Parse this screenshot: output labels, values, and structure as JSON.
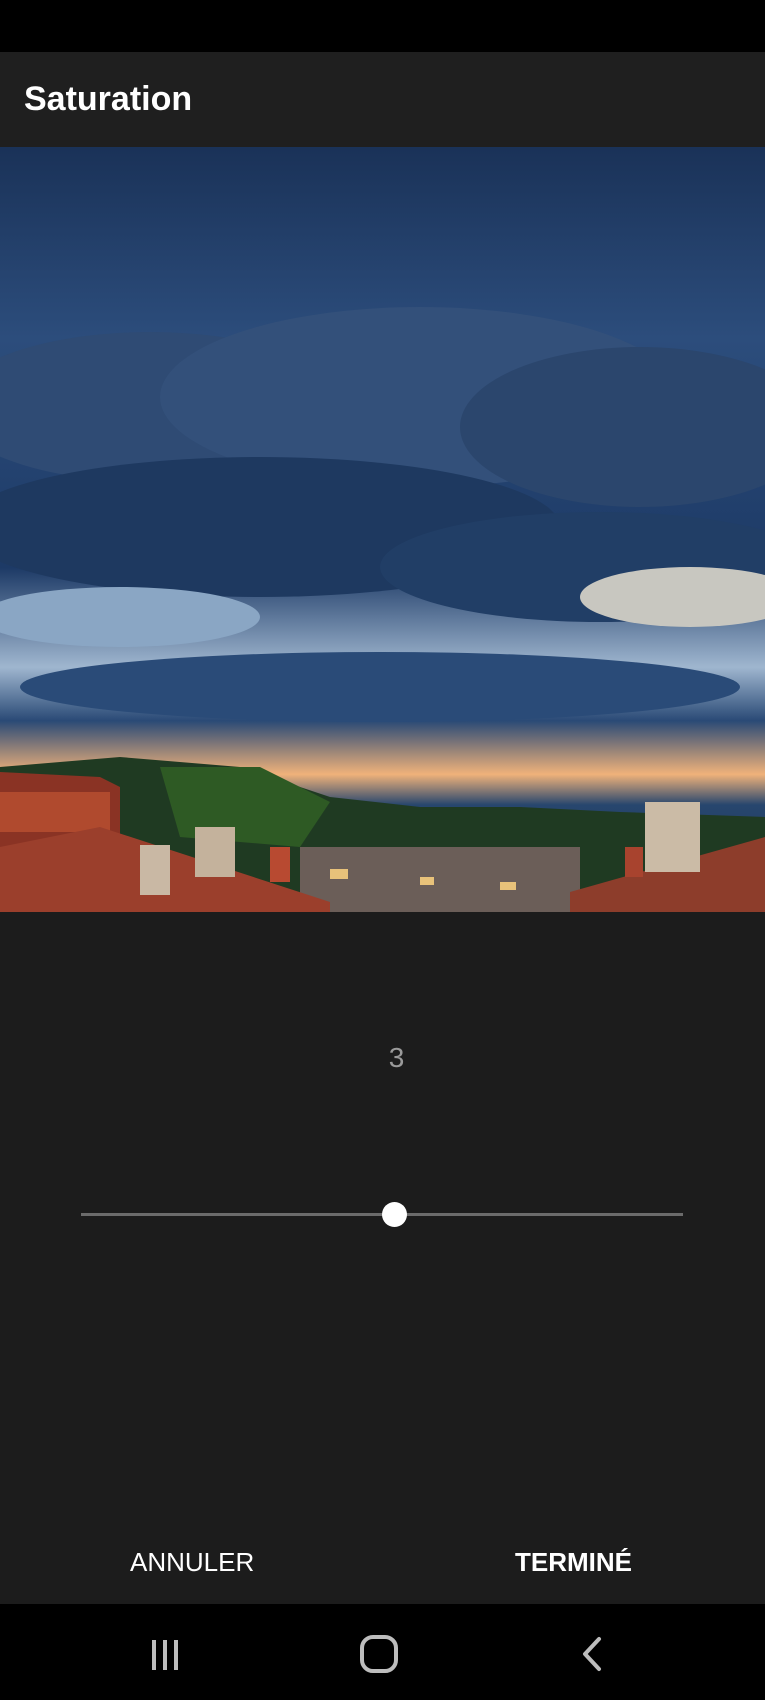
{
  "header": {
    "title": "Saturation"
  },
  "photo": {
    "icon": "landscape-photo"
  },
  "adjustment": {
    "value": "3",
    "slider_position": 0.52
  },
  "actions": {
    "cancel_label": "ANNULER",
    "done_label": "TERMINÉ"
  },
  "nav": {
    "recents_icon": "recents-icon",
    "home_icon": "home-icon",
    "back_icon": "back-icon"
  },
  "colors": {
    "background": "#1c1c1c",
    "app_bar": "#1f1f1f",
    "accent": "#ffffff",
    "track": "#6b6b6b"
  }
}
